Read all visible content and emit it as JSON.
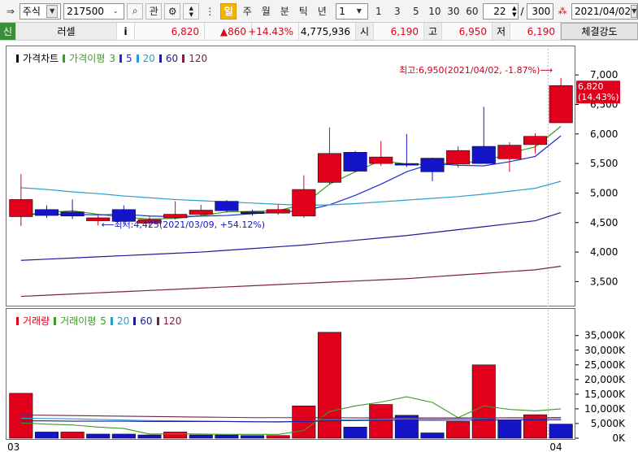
{
  "toolbar": {
    "market_select": "주식",
    "code_input": "217500",
    "btn_gwan": "관",
    "period_buttons": [
      "일",
      "주",
      "월",
      "분",
      "틱",
      "년"
    ],
    "period_selected": "일",
    "interval_select": "1",
    "interval_buttons": [
      "1",
      "3",
      "5",
      "10",
      "30",
      "60"
    ],
    "view_count": "22",
    "total_count": "300",
    "date_field": "2021/04/02",
    "slash": "/"
  },
  "infobar": {
    "credit_label": "신",
    "stock_name": "러셀",
    "info_btn": "i",
    "price": "6,820",
    "change": "▲860",
    "change_pct": "+14.43%",
    "volume": "4,775,936",
    "open_label": "시",
    "open_value": "6,190",
    "high_label": "고",
    "high_value": "6,950",
    "low_label": "저",
    "low_value": "6,190",
    "strength_btn": "체결강도"
  },
  "price_legend": {
    "title": "가격차트",
    "ma_label": "가격이평",
    "ma_periods": [
      "3",
      "5",
      "20",
      "60",
      "120"
    ],
    "colors": [
      "#3c9b23",
      "#1f2ad6",
      "#2b9bd0",
      "#1c1c9a",
      "#7a1f4a"
    ]
  },
  "volume_legend": {
    "title": "거래량",
    "ma_label": "거래이평",
    "ma_periods": [
      "5",
      "20",
      "60",
      "120"
    ]
  },
  "annotations": {
    "high": "최고:6,950(2021/04/02, -1.87%)",
    "low": "최저:4,425(2021/03/09, +54.12%)",
    "current_price": "6,820",
    "current_pct": "(14.43%)"
  },
  "chart_data": [
    {
      "type": "candlestick",
      "title": "",
      "y_ticks": [
        3500,
        4000,
        4500,
        5000,
        5500,
        6000,
        6500,
        7000
      ],
      "y_tick_labels": [
        "3,500",
        "4,000",
        "4,500",
        "5,000",
        "5,500",
        "6,000",
        "6,500",
        "7,000"
      ],
      "ylim": [
        3120,
        7250
      ],
      "x_tick_labels": [
        "03",
        "04"
      ],
      "up_color": "#e0001b",
      "down_color": "#1414c8",
      "candles": [
        {
          "o": 4600,
          "h": 5320,
          "l": 4440,
          "c": 4890
        },
        {
          "o": 4720,
          "h": 4790,
          "l": 4580,
          "c": 4620
        },
        {
          "o": 4680,
          "h": 4890,
          "l": 4560,
          "c": 4610
        },
        {
          "o": 4530,
          "h": 4620,
          "l": 4450,
          "c": 4580
        },
        {
          "o": 4720,
          "h": 4790,
          "l": 4470,
          "c": 4520
        },
        {
          "o": 4490,
          "h": 4600,
          "l": 4430,
          "c": 4550
        },
        {
          "o": 4580,
          "h": 4860,
          "l": 4550,
          "c": 4640
        },
        {
          "o": 4640,
          "h": 4800,
          "l": 4600,
          "c": 4710
        },
        {
          "o": 4860,
          "h": 4880,
          "l": 4670,
          "c": 4700
        },
        {
          "o": 4680,
          "h": 4720,
          "l": 4620,
          "c": 4660
        },
        {
          "o": 4660,
          "h": 4800,
          "l": 4630,
          "c": 4720
        },
        {
          "o": 4610,
          "h": 5300,
          "l": 4580,
          "c": 5060
        },
        {
          "o": 5180,
          "h": 6110,
          "l": 5150,
          "c": 5670
        },
        {
          "o": 5690,
          "h": 5710,
          "l": 5360,
          "c": 5370
        },
        {
          "o": 5500,
          "h": 5880,
          "l": 5460,
          "c": 5610
        },
        {
          "o": 5500,
          "h": 6000,
          "l": 5440,
          "c": 5480
        },
        {
          "o": 5590,
          "h": 5600,
          "l": 5200,
          "c": 5360
        },
        {
          "o": 5490,
          "h": 5790,
          "l": 5430,
          "c": 5720
        },
        {
          "o": 5790,
          "h": 6460,
          "l": 5560,
          "c": 5500
        },
        {
          "o": 5580,
          "h": 5860,
          "l": 5360,
          "c": 5810
        },
        {
          "o": 5820,
          "h": 6010,
          "l": 5670,
          "c": 5960
        },
        {
          "o": 6190,
          "h": 6950,
          "l": 6190,
          "c": 6820
        }
      ],
      "ma_series": [
        {
          "name": "3",
          "values": [
            4610,
            4670,
            4700,
            4640,
            4590,
            4560,
            4570,
            4620,
            4680,
            4690,
            4700,
            4810,
            5150,
            5360,
            5550,
            5490,
            5480,
            5520,
            5530,
            5680,
            5780,
            6130
          ]
        },
        {
          "name": "5",
          "values": [
            4650,
            4640,
            4640,
            4630,
            4640,
            4610,
            4600,
            4610,
            4620,
            4650,
            4680,
            4700,
            4800,
            4960,
            5150,
            5360,
            5500,
            5470,
            5460,
            5530,
            5620,
            5970
          ]
        },
        {
          "name": "20",
          "values": [
            5090,
            5060,
            5020,
            4990,
            4950,
            4920,
            4890,
            4870,
            4850,
            4830,
            4810,
            4790,
            4800,
            4820,
            4850,
            4880,
            4910,
            4940,
            4980,
            5030,
            5080,
            5200
          ]
        },
        {
          "name": "60",
          "values": [
            3860,
            3880,
            3900,
            3920,
            3940,
            3960,
            3980,
            4000,
            4030,
            4060,
            4090,
            4120,
            4160,
            4200,
            4240,
            4280,
            4330,
            4380,
            4430,
            4480,
            4530,
            4670
          ]
        },
        {
          "name": "120",
          "values": [
            3250,
            3270,
            3290,
            3310,
            3330,
            3350,
            3370,
            3390,
            3410,
            3430,
            3450,
            3470,
            3490,
            3510,
            3530,
            3550,
            3580,
            3610,
            3640,
            3670,
            3700,
            3760
          ]
        }
      ]
    },
    {
      "type": "bar",
      "title": "",
      "y_ticks": [
        0,
        5000,
        10000,
        15000,
        20000,
        25000,
        30000,
        35000
      ],
      "y_tick_labels": [
        "0K",
        "5,000K",
        "10,000K",
        "15,000K",
        "20,000K",
        "25,000K",
        "30,000K",
        "35,000K"
      ],
      "ylim": [
        0,
        38800
      ],
      "values_k": [
        15300,
        2100,
        2100,
        1400,
        1400,
        1100,
        2100,
        1100,
        1100,
        900,
        900,
        11000,
        36100,
        3800,
        11500,
        7800,
        1800,
        5700,
        25000,
        6300,
        8000,
        4800
      ],
      "up_flags": [
        1,
        0,
        1,
        0,
        0,
        0,
        1,
        0,
        0,
        0,
        1,
        1,
        1,
        0,
        1,
        0,
        0,
        1,
        1,
        0,
        1,
        0
      ],
      "ma_series": [
        {
          "name": "5",
          "values": [
            5200,
            4800,
            4500,
            3800,
            3300,
            1400,
            1500,
            1400,
            1300,
            1300,
            1300,
            2600,
            9100,
            11000,
            12300,
            14100,
            12200,
            7000,
            11000,
            9800,
            9300,
            10000
          ]
        },
        {
          "name": "20",
          "values": [
            6800,
            6700,
            6600,
            6400,
            6200,
            6000,
            5900,
            5800,
            5700,
            5600,
            5500,
            5700,
            6300,
            6200,
            6400,
            6600,
            6500,
            6600,
            6800,
            7000,
            6900,
            7100
          ]
        },
        {
          "name": "60",
          "values": [
            5900,
            5900,
            5800,
            5800,
            5800,
            5700,
            5700,
            5700,
            5700,
            5600,
            5600,
            5700,
            6000,
            6000,
            6100,
            6100,
            6100,
            6100,
            6200,
            6200,
            6300,
            6300
          ]
        },
        {
          "name": "120",
          "values": [
            7900,
            7800,
            7700,
            7600,
            7500,
            7400,
            7300,
            7200,
            7100,
            7000,
            7000,
            7000,
            7000,
            6900,
            6900,
            6900,
            6900,
            6900,
            6900,
            6900,
            6900,
            6900
          ]
        }
      ]
    }
  ]
}
